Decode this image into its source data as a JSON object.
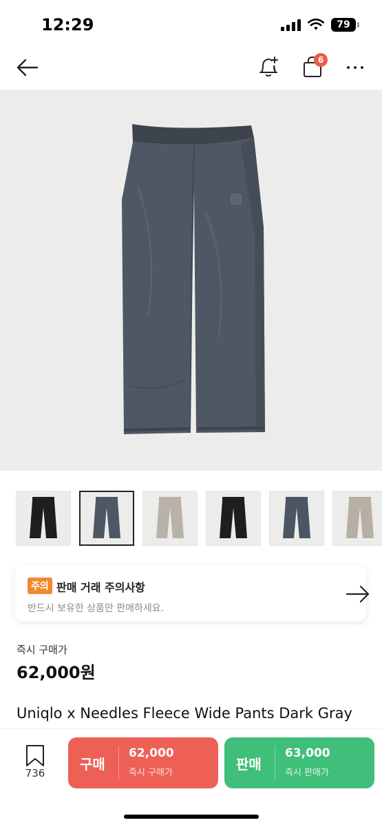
{
  "status_bar": {
    "time": "12:29",
    "battery": "79"
  },
  "nav": {
    "cart_count": "6"
  },
  "thumbnails": [
    {
      "color": "#1e1e1e"
    },
    {
      "color": "#4e5763"
    },
    {
      "color": "#b9b2a8"
    },
    {
      "color": "#1e1e1e"
    },
    {
      "color": "#4c5563"
    },
    {
      "color": "#b7afa4"
    }
  ],
  "notice": {
    "badge": "주의",
    "title": "판매 거래 주의사항",
    "description": "반드시 보유한 상품만 판매하세요."
  },
  "product": {
    "instant_label": "즉시 구매가",
    "price": "62,000원",
    "title": "Uniqlo x Needles Fleece Wide Pants Dark Gray"
  },
  "bottom_bar": {
    "bookmark_count": "736",
    "buy": {
      "label": "구매",
      "price": "62,000",
      "sub": "즉시 구매가"
    },
    "sell": {
      "label": "판매",
      "price": "63,000",
      "sub": "즉시 판매가"
    }
  },
  "colors": {
    "buy": "#ee5f55",
    "sell": "#3fbf79",
    "notice_badge": "#f08a2c",
    "badge": "#ef5a4a",
    "pants_main": "#4e5763"
  }
}
